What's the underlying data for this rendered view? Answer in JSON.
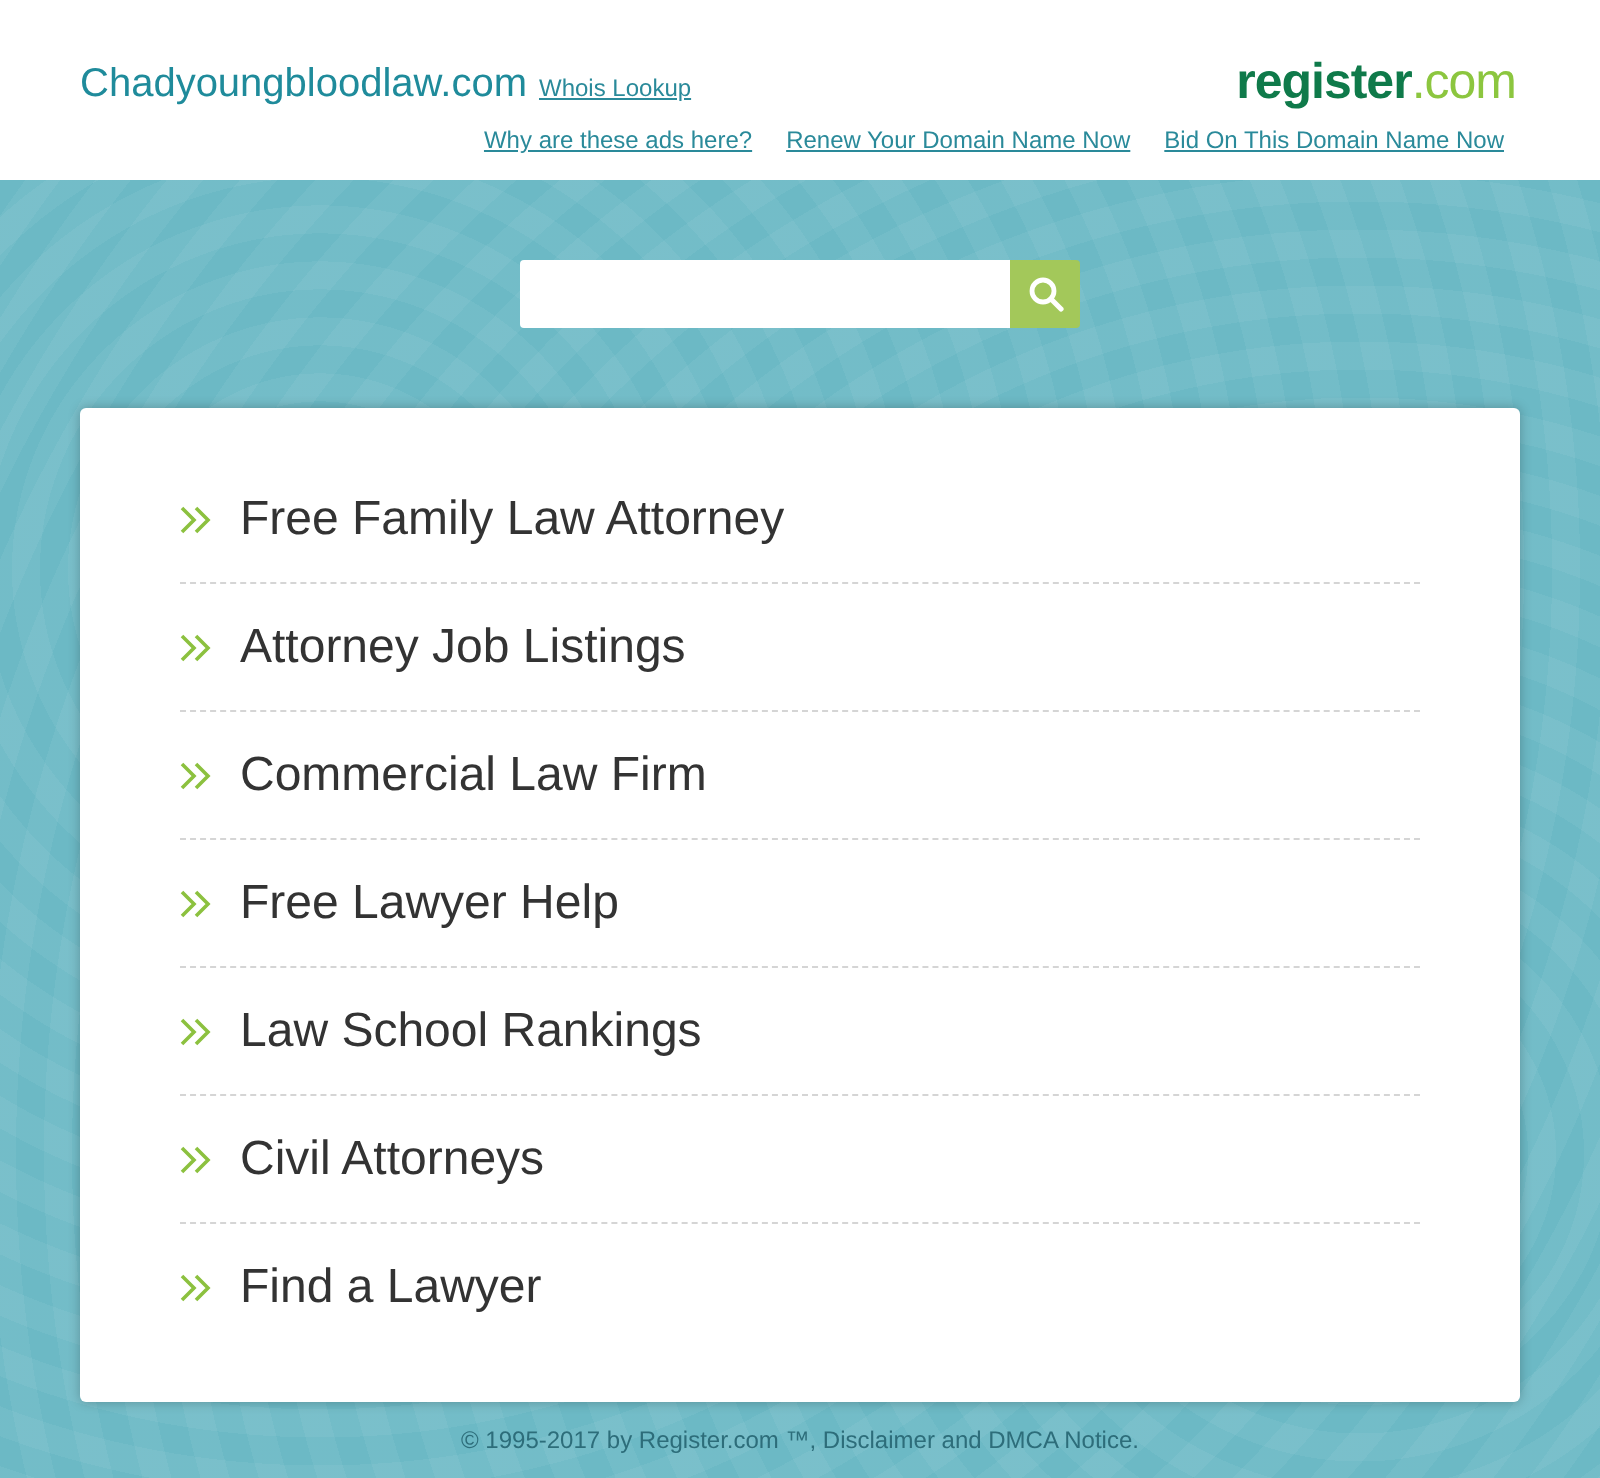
{
  "header": {
    "domain": "Chadyoungbloodlaw.com",
    "whois_link": "Whois Lookup",
    "logo": {
      "name": "register",
      "suffix": ".com"
    },
    "links": [
      "Why are these ads here?",
      "Renew Your Domain Name Now",
      "Bid On This Domain Name Now"
    ]
  },
  "results": [
    "Free Family Law Attorney",
    "Attorney Job Listings",
    "Commercial Law Firm",
    "Free Lawyer Help",
    "Law School Rankings",
    "Civil Attorneys",
    "Find a Lawyer"
  ],
  "footer": "© 1995-2017 by Register.com ™, Disclaimer and DMCA Notice."
}
